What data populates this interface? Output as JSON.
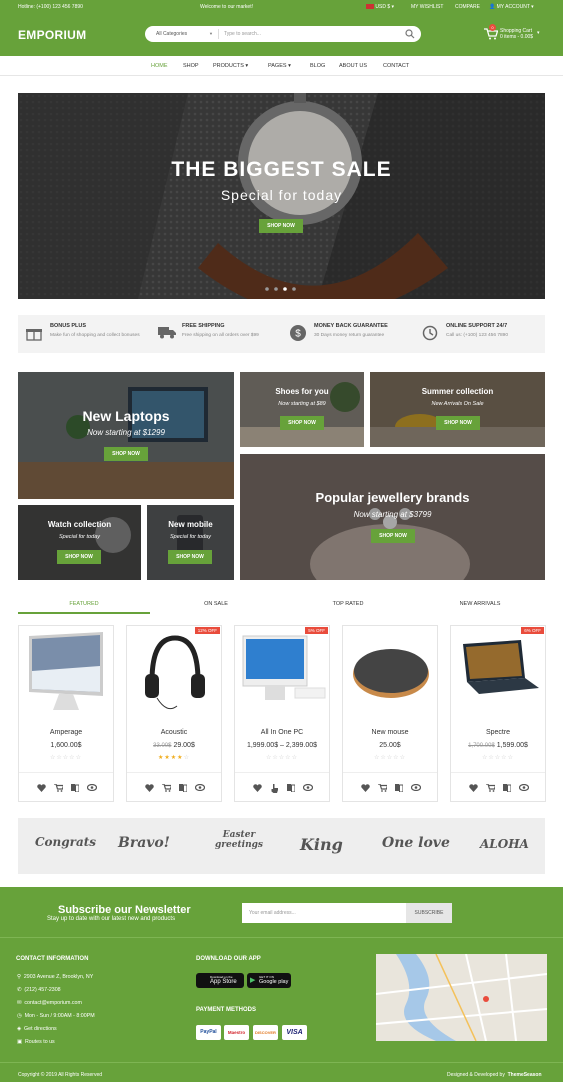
{
  "topbar": {
    "hotline": "Hotline: (+100) 123 456 7890",
    "welcome": "Welcome to our market!",
    "currency": "USD $",
    "wishlist": "MY WISHLIST",
    "compare": "COMPARE",
    "account": "MY ACCOUNT"
  },
  "header": {
    "logo": "EMPORIUM",
    "category": "All Categories",
    "search_placeholder": "Type to search...",
    "cart_title": "Shopping Cart",
    "cart_summary": "0 items - 0.00$",
    "cart_count": "0"
  },
  "nav": [
    "HOME",
    "SHOP",
    "PRODUCTS",
    "PAGES",
    "BLOG",
    "ABOUT US",
    "CONTACT"
  ],
  "hero": {
    "title": "THE BIGGEST SALE",
    "subtitle": "Special for today",
    "button": "SHOP NOW"
  },
  "features": [
    {
      "title": "BONUS PLUS",
      "desc": "Make fun of shopping and collect bonuses",
      "icon": "gift-icon"
    },
    {
      "title": "FREE SHIPPING",
      "desc": "Free shipping on all orders over $99",
      "icon": "truck-icon"
    },
    {
      "title": "MONEY BACK GUARANTEE",
      "desc": "30 Days money return guarantee",
      "icon": "dollar-icon"
    },
    {
      "title": "ONLINE SUPPORT 24/7",
      "desc": "Call us: (+100) 123 456 7890",
      "icon": "clock-icon"
    }
  ],
  "banners": {
    "laptops": {
      "title": "New Laptops",
      "sub": "Now starting at $1299",
      "button": "SHOP NOW"
    },
    "shoes": {
      "title": "Shoes for you",
      "sub": "Now starting at $89",
      "button": "SHOP NOW"
    },
    "summer": {
      "title": "Summer collection",
      "sub": "New Arrivals On Sale",
      "button": "SHOP NOW"
    },
    "jewellery": {
      "title": "Popular jewellery brands",
      "sub": "Now starting at $3799",
      "button": "SHOP NOW"
    },
    "watch": {
      "title": "Watch collection",
      "sub": "Special for today",
      "button": "SHOP NOW"
    },
    "mobile": {
      "title": "New mobile",
      "sub": "Special for today",
      "button": "SHOP NOW"
    }
  },
  "tabs": [
    "FEATURED",
    "ON SALE",
    "TOP RATED",
    "NEW ARRIVALS"
  ],
  "products": [
    {
      "name": "Amperage",
      "price": "1,600.00$",
      "old": "",
      "badge": "",
      "rating": 0
    },
    {
      "name": "Acoustic",
      "price": "29.00$",
      "old": "33.00$",
      "badge": "12% OFF",
      "rating": 4
    },
    {
      "name": "All In One PC",
      "price": "1,999.00$ – 2,399.00$",
      "old": "",
      "badge": "5% OFF",
      "rating": 0
    },
    {
      "name": "New mouse",
      "price": "25.00$",
      "old": "",
      "badge": "",
      "rating": 0
    },
    {
      "name": "Spectre",
      "price": "1,599.00$",
      "old": "1,700.00$",
      "badge": "6% OFF",
      "rating": 0
    }
  ],
  "brands": [
    "Congrats",
    "Bravo!",
    "Easter greetings",
    "King",
    "One love",
    "ALOHA"
  ],
  "newsletter": {
    "title": "Subscribe our Newsletter",
    "sub": "Stay up to date with our latest new and products",
    "placeholder": "Your email address...",
    "button": "SUBSCRIBE"
  },
  "contact": {
    "heading": "CONTACT INFORMATION",
    "address": "2903 Avenue Z, Brooklyn, NY",
    "phone": "(212) 457-2308",
    "email": "contact@emporium.com",
    "hours": "Mon - Sun / 9:00AM - 8:00PM",
    "directions": "Get directions",
    "routes": "Routes to us"
  },
  "app": {
    "heading": "DOWNLOAD OUR APP",
    "appstore": "App Store",
    "googleplay": "Google play",
    "appstore_small": "Download on the",
    "googleplay_small": "GET IT ON"
  },
  "payments": {
    "heading": "PAYMENT METHODS",
    "items": [
      "PayPal",
      "Maestro",
      "DISCOVER",
      "VISA"
    ]
  },
  "footer": {
    "copyright": "Copyright © 2019 All Rights Reserved",
    "designed": "Designed & Developed by",
    "brand": "ThemeSeason"
  },
  "colors": {
    "accent": "#67a23a",
    "sale": "#e94c3c"
  }
}
